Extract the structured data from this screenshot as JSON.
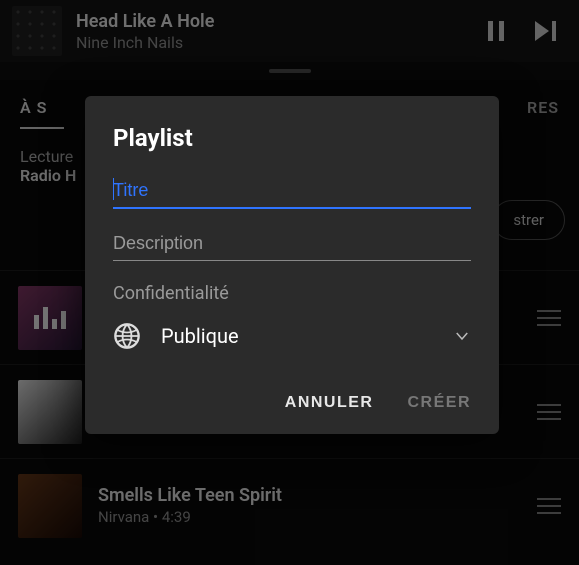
{
  "now_playing": {
    "title": "Head Like A Hole",
    "artist": "Nine Inch Nails"
  },
  "tabs": {
    "left_fragment": "À S",
    "right_fragment": "RES"
  },
  "context": {
    "line1": "Lecture",
    "line2": "Radio H"
  },
  "register_button_fragment": "strer",
  "songs": [
    {
      "title": "",
      "sub": ""
    },
    {
      "title": "",
      "sub": ""
    },
    {
      "title": "Smells Like Teen Spirit",
      "sub": "Nirvana • 4:39"
    }
  ],
  "modal": {
    "heading": "Playlist",
    "title_placeholder": "Titre",
    "description_placeholder": "Description",
    "privacy_label": "Confidentialité",
    "privacy_value": "Publique",
    "cancel": "ANNULER",
    "create": "CRÉER"
  }
}
